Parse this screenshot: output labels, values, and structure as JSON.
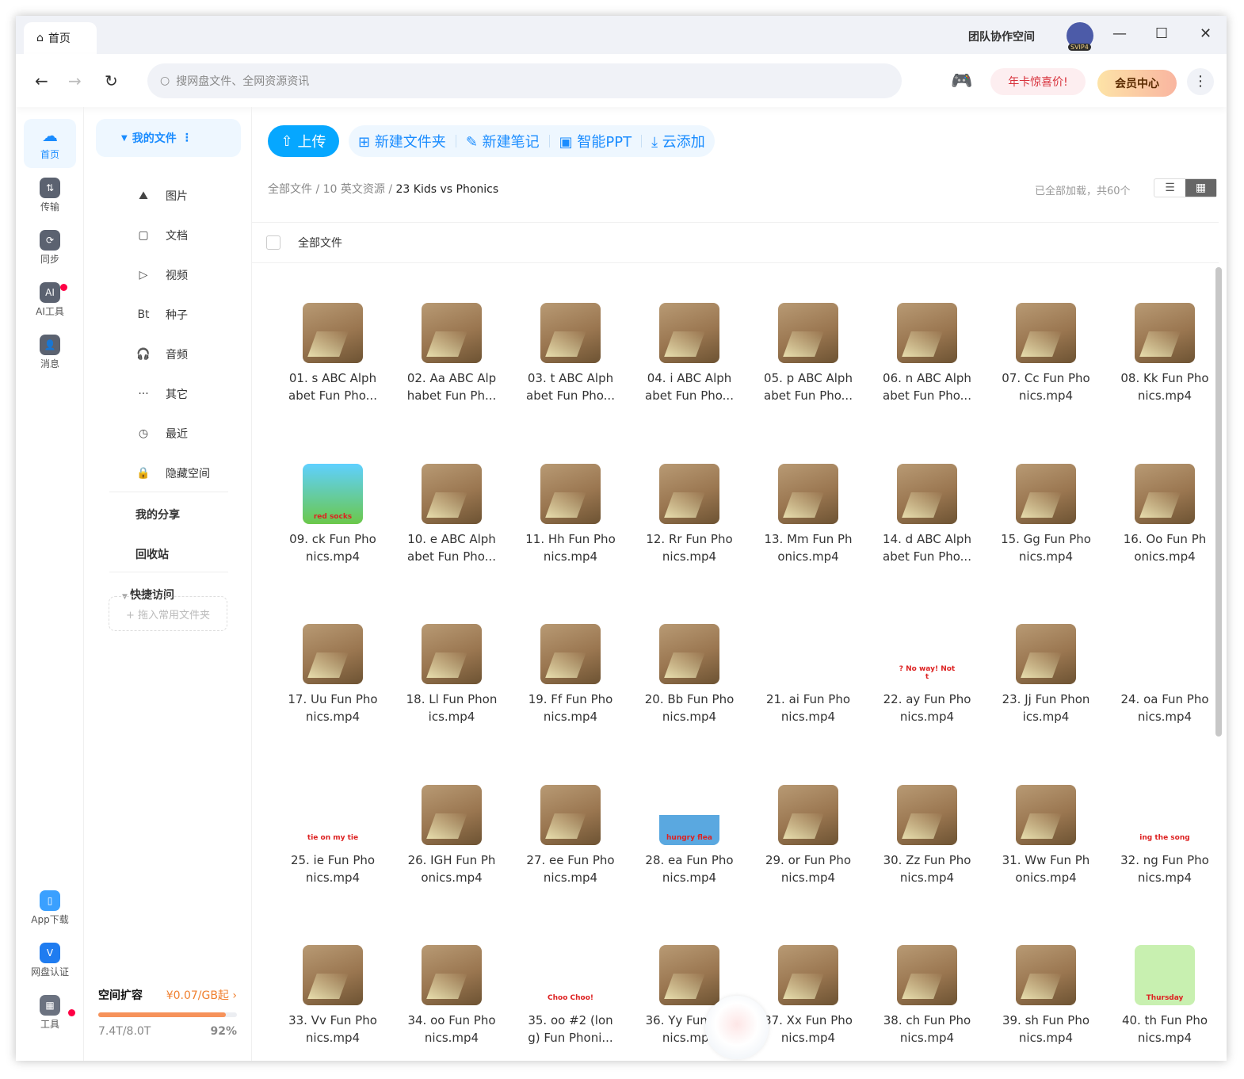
{
  "titlebar": {
    "tab": "首页",
    "team": "团队协作空间",
    "avatar_badge": "SVIP4"
  },
  "navbar": {
    "search_placeholder": "搜网盘文件、全网资源资讯",
    "promo": "年卡惊喜价!",
    "vip": "会员中心"
  },
  "rail": [
    {
      "label": "首页",
      "icon": "home-cloud-icon"
    },
    {
      "label": "传输",
      "icon": "transfer-icon"
    },
    {
      "label": "同步",
      "icon": "sync-icon"
    },
    {
      "label": "AI工具",
      "icon": "ai-icon"
    },
    {
      "label": "消息",
      "icon": "message-icon"
    }
  ],
  "rail_bottom": [
    {
      "label": "App下载",
      "icon": "phone-icon"
    },
    {
      "label": "网盘认证",
      "icon": "verify-icon"
    },
    {
      "label": "工具",
      "icon": "tools-icon"
    }
  ],
  "sidebar": {
    "my_files": "我的文件",
    "items": [
      {
        "label": "图片",
        "glyph": "⛰"
      },
      {
        "label": "文档",
        "glyph": "▢"
      },
      {
        "label": "视频",
        "glyph": "▷"
      },
      {
        "label": "种子",
        "glyph": "Bt"
      },
      {
        "label": "音频",
        "glyph": "🎧"
      },
      {
        "label": "其它",
        "glyph": "···"
      },
      {
        "label": "最近",
        "glyph": "◷"
      },
      {
        "label": "隐藏空间",
        "glyph": "🔒"
      }
    ],
    "share": "我的分享",
    "trash": "回收站",
    "quick": "快捷访问",
    "drop_hint": "+ 拖入常用文件夹"
  },
  "quota": {
    "title": "空间扩容",
    "price": "¥0.07/GB起 ›",
    "used": "7.4T/8.0T",
    "percent": "92%",
    "fraction": 0.92,
    "color": "#f6925a"
  },
  "toolbar": {
    "upload": "上传",
    "new_folder": "新建文件夹",
    "new_note": "新建笔记",
    "smart_ppt": "智能PPT",
    "cloud_add": "云添加"
  },
  "breadcrumb": {
    "parts": [
      "全部文件",
      "10 英文资源"
    ],
    "current": "23 Kids vs Phonics",
    "sep": " / "
  },
  "count": "已全部加载，共60个",
  "all_files": "全部文件",
  "accent": "#06a7ff",
  "files": [
    [
      "01. s ABC Alph",
      "abet Fun Pho...",
      ""
    ],
    [
      "02. Aa ABC Alp",
      "habet Fun Ph...",
      ""
    ],
    [
      "03. t ABC Alph",
      "abet Fun Pho...",
      ""
    ],
    [
      "04. i ABC Alph",
      "abet Fun Pho...",
      ""
    ],
    [
      "05. p ABC Alph",
      "abet Fun Pho...",
      ""
    ],
    [
      "06. n ABC Alph",
      "abet Fun Pho...",
      ""
    ],
    [
      "07. Cc Fun Pho",
      "nics.mp4",
      ""
    ],
    [
      "08. Kk Fun Pho",
      "nics.mp4",
      ""
    ],
    [
      "09. ck Fun Pho",
      "nics.mp4",
      "red socks"
    ],
    [
      "10. e ABC Alph",
      "abet Fun Pho...",
      ""
    ],
    [
      "11. Hh Fun Pho",
      "nics.mp4",
      ""
    ],
    [
      "12. Rr Fun Pho",
      "nics.mp4",
      ""
    ],
    [
      "13. Mm Fun Ph",
      "onics.mp4",
      ""
    ],
    [
      "14. d ABC Alph",
      "abet Fun Pho...",
      ""
    ],
    [
      "15. Gg Fun Pho",
      "nics.mp4",
      ""
    ],
    [
      "16. Oo Fun Ph",
      "onics.mp4",
      ""
    ],
    [
      "17. Uu Fun Pho",
      "nics.mp4",
      ""
    ],
    [
      "18. Ll Fun Phon",
      "ics.mp4",
      ""
    ],
    [
      "19. Ff Fun Pho",
      "nics.mp4",
      ""
    ],
    [
      "20. Bb Fun Pho",
      "nics.mp4",
      ""
    ],
    [
      "21. ai Fun Pho",
      "nics.mp4",
      "none"
    ],
    [
      "22. ay Fun Pho",
      "nics.mp4",
      "? No way! Not t"
    ],
    [
      "23. Jj Fun Phon",
      "ics.mp4",
      ""
    ],
    [
      "24. oa Fun Pho",
      "nics.mp4",
      "none"
    ],
    [
      "25. ie Fun Pho",
      "nics.mp4",
      "tie on my tie"
    ],
    [
      "26. IGH Fun Ph",
      "onics.mp4",
      ""
    ],
    [
      "27. ee Fun Pho",
      "nics.mp4",
      ""
    ],
    [
      "28. ea Fun Pho",
      "nics.mp4",
      "hungry flea"
    ],
    [
      "29. or Fun Pho",
      "nics.mp4",
      ""
    ],
    [
      "30. Zz Fun Pho",
      "nics.mp4",
      ""
    ],
    [
      "31. Ww Fun Ph",
      "onics.mp4",
      ""
    ],
    [
      "32. ng Fun Pho",
      "nics.mp4",
      "ing the song"
    ],
    [
      "33. Vv Fun Pho",
      "nics.mp4",
      ""
    ],
    [
      "34. oo Fun Pho",
      "nics.mp4",
      ""
    ],
    [
      "35. oo #2 (lon",
      "g) Fun Phoni...",
      "Choo Choo!"
    ],
    [
      "36. Yy Fun Pho",
      "nics.mp4",
      ""
    ],
    [
      "37. Xx Fun Pho",
      "nics.mp4",
      ""
    ],
    [
      "38. ch Fun Pho",
      "nics.mp4",
      ""
    ],
    [
      "39. sh Fun Pho",
      "nics.mp4",
      ""
    ],
    [
      "40. th Fun Pho",
      "nics.mp4",
      "Thursday"
    ]
  ]
}
